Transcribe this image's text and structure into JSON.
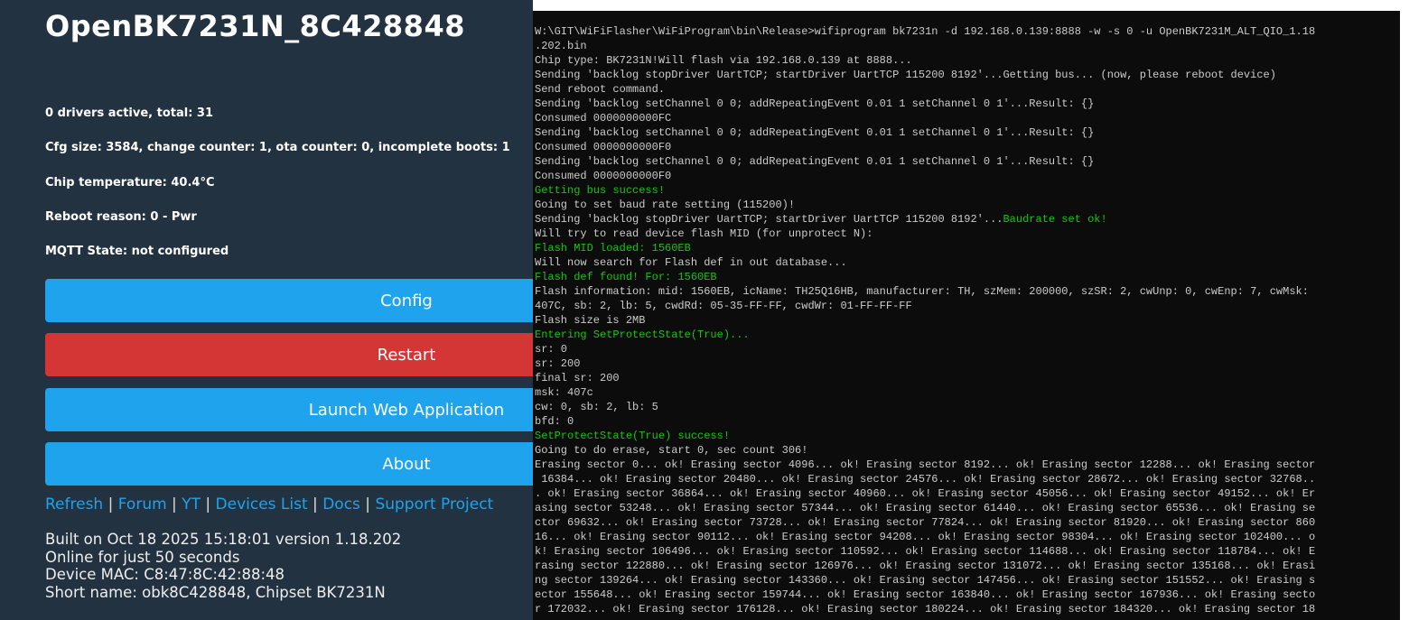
{
  "device": {
    "title": "OpenBK7231N_8C428848",
    "info": [
      "0 drivers active, total: 31",
      "Cfg size: 3584, change counter: 1, ota counter: 0, incomplete boots: 1",
      "Chip temperature: 40.4°C",
      "Reboot reason: 0 - Pwr",
      "MQTT State: not configured"
    ],
    "buttons": [
      {
        "label": "Config",
        "color": "#1fa3ec"
      },
      {
        "label": "Restart",
        "color": "#d43535"
      },
      {
        "label": "Launch Web Application",
        "color": "#1fa3ec"
      },
      {
        "label": "About",
        "color": "#1fa3ec"
      }
    ],
    "links": [
      "Refresh",
      "Forum",
      "YT",
      "Devices List",
      "Docs",
      "Support Project"
    ],
    "footer": [
      "Built on Oct 18 2025 15:18:01 version 1.18.202",
      "Online for just 50 seconds",
      "Device MAC: C8:47:8C:42:88:48",
      "Short name: obk8C428848, Chipset BK7231N"
    ]
  },
  "terminal": {
    "lines": [
      [
        [
          "W:\\GIT\\WiFiFlasher\\WiFiProgram\\bin\\Release>wifiprogram bk7231n -d 192.168.0.139:8888 -w -s 0 -u OpenBK7231M_ALT_QIO_1.18",
          ""
        ]
      ],
      [
        [
          ".202.bin",
          ""
        ]
      ],
      [
        [
          "Chip type: BK7231N!Will flash via 192.168.0.139 at 8888...",
          ""
        ]
      ],
      [
        [
          "Sending 'backlog stopDriver UartTCP; startDriver UartTCP 115200 8192'...Getting bus... (now, please reboot device)",
          ""
        ]
      ],
      [
        [
          "Send reboot command.",
          ""
        ]
      ],
      [
        [
          "Sending 'backlog setChannel 0 0; addRepeatingEvent 0.01 1 setChannel 0 1'...Result: {}",
          ""
        ]
      ],
      [
        [
          "Consumed 0000000000FC",
          ""
        ]
      ],
      [
        [
          "Sending 'backlog setChannel 0 0; addRepeatingEvent 0.01 1 setChannel 0 1'...Result: {}",
          ""
        ]
      ],
      [
        [
          "Consumed 0000000000F0",
          ""
        ]
      ],
      [
        [
          "Sending 'backlog setChannel 0 0; addRepeatingEvent 0.01 1 setChannel 0 1'...Result: {}",
          ""
        ]
      ],
      [
        [
          "Consumed 0000000000F0",
          ""
        ]
      ],
      [
        [
          "Getting bus success!",
          "g"
        ]
      ],
      [
        [
          "Going to set baud rate setting (115200)!",
          ""
        ]
      ],
      [
        [
          "Sending 'backlog stopDriver UartTCP; startDriver UartTCP 115200 8192'...",
          ""
        ],
        [
          "Baudrate set ok!",
          "g"
        ]
      ],
      [
        [
          "Will try to read device flash MID (for unprotect N):",
          ""
        ]
      ],
      [
        [
          "Flash MID loaded: 1560EB",
          "g"
        ]
      ],
      [
        [
          "Will now search for Flash def in out database...",
          ""
        ]
      ],
      [
        [
          "Flash def found! For: 1560EB",
          "g"
        ]
      ],
      [
        [
          "Flash information: mid: 1560EB, icName: TH25Q16HB, manufacturer: TH, szMem: 200000, szSR: 2, cwUnp: 0, cwEnp: 7, cwMsk:",
          ""
        ]
      ],
      [
        [
          "407C, sb: 2, lb: 5, cwdRd: 05-35-FF-FF, cwdWr: 01-FF-FF-FF",
          ""
        ]
      ],
      [
        [
          "Flash size is 2MB",
          ""
        ]
      ],
      [
        [
          "Entering SetProtectState(True)...",
          "g"
        ]
      ],
      [
        [
          "sr: 0",
          ""
        ]
      ],
      [
        [
          "sr: 200",
          ""
        ]
      ],
      [
        [
          "final sr: 200",
          ""
        ]
      ],
      [
        [
          "msk: 407c",
          ""
        ]
      ],
      [
        [
          "cw: 0, sb: 2, lb: 5",
          ""
        ]
      ],
      [
        [
          "bfd: 0",
          ""
        ]
      ],
      [
        [
          "SetProtectState(True) success!",
          "g"
        ]
      ],
      [
        [
          "Going to do erase, start 0, sec count 306!",
          ""
        ]
      ],
      [
        [
          "Erasing sector 0... ok! Erasing sector 4096... ok! Erasing sector 8192... ok! Erasing sector 12288... ok! Erasing sector",
          ""
        ]
      ],
      [
        [
          " 16384... ok! Erasing sector 20480... ok! Erasing sector 24576... ok! Erasing sector 28672... ok! Erasing sector 32768..",
          ""
        ]
      ],
      [
        [
          ". ok! Erasing sector 36864... ok! Erasing sector 40960... ok! Erasing sector 45056... ok! Erasing sector 49152... ok! Er",
          ""
        ]
      ],
      [
        [
          "asing sector 53248... ok! Erasing sector 57344... ok! Erasing sector 61440... ok! Erasing sector 65536... ok! Erasing se",
          ""
        ]
      ],
      [
        [
          "ctor 69632... ok! Erasing sector 73728... ok! Erasing sector 77824... ok! Erasing sector 81920... ok! Erasing sector 860",
          ""
        ]
      ],
      [
        [
          "16... ok! Erasing sector 90112... ok! Erasing sector 94208... ok! Erasing sector 98304... ok! Erasing sector 102400... o",
          ""
        ]
      ],
      [
        [
          "k! Erasing sector 106496... ok! Erasing sector 110592... ok! Erasing sector 114688... ok! Erasing sector 118784... ok! E",
          ""
        ]
      ],
      [
        [
          "rasing sector 122880... ok! Erasing sector 126976... ok! Erasing sector 131072... ok! Erasing sector 135168... ok! Erasi",
          ""
        ]
      ],
      [
        [
          "ng sector 139264... ok! Erasing sector 143360... ok! Erasing sector 147456... ok! Erasing sector 151552... ok! Erasing s",
          ""
        ]
      ],
      [
        [
          "ector 155648... ok! Erasing sector 159744... ok! Erasing sector 163840... ok! Erasing sector 167936... ok! Erasing secto",
          ""
        ]
      ],
      [
        [
          "r 172032... ok! Erasing sector 176128... ok! Erasing sector 180224... ok! Erasing sector 184320... ok! Erasing sector 18",
          ""
        ]
      ]
    ]
  }
}
